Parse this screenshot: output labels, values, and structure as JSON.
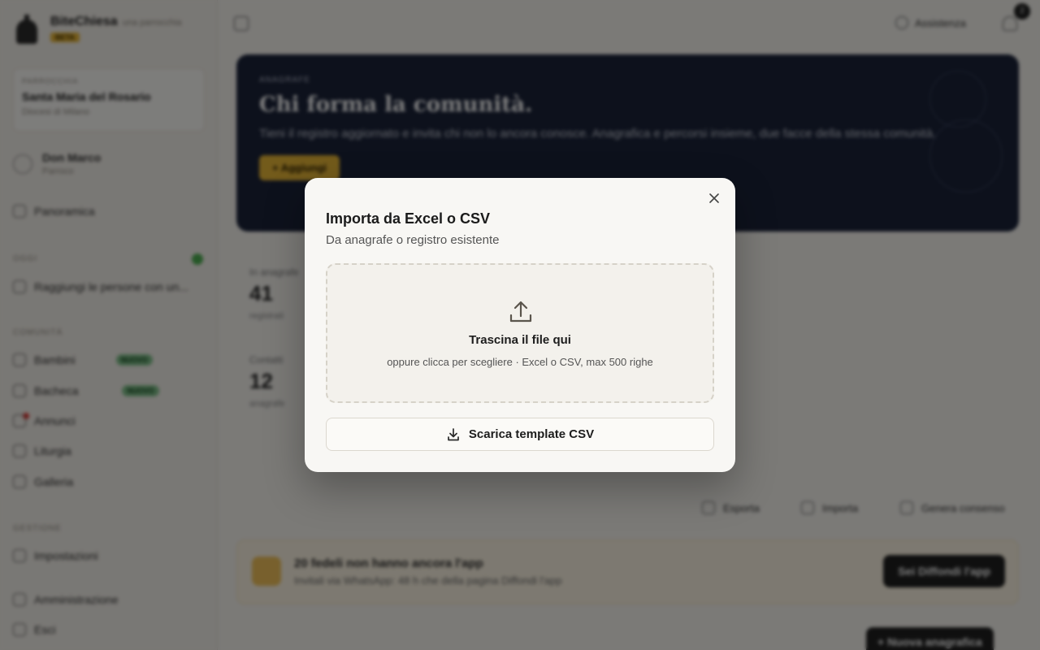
{
  "app": {
    "name": "BiteChiesa",
    "subtitle": "una parrocchia",
    "badge": "BETA"
  },
  "sidebar": {
    "parish_label": "Parrocchia",
    "parish_name": "Santa Maria del Rosario",
    "parish_sub": "Diocesi di Milano",
    "user_name": "Don Marco",
    "user_role": "Parroco",
    "dashboard": "Panoramica",
    "section_today": "Oggi",
    "today_item": "Raggiungi le persone con un...",
    "section_community": "Comunità",
    "items": [
      {
        "label": "Bambini",
        "pill": "NUOVO"
      },
      {
        "label": "Bacheca",
        "pill": "NUOVO"
      },
      {
        "label": "Annunci",
        "pill": ""
      },
      {
        "label": "Liturgia",
        "pill": ""
      },
      {
        "label": "Galleria",
        "pill": ""
      }
    ],
    "section_settings": "Gestione",
    "settings_item": "Impostazioni",
    "bottom_items": [
      "Amministrazione",
      "Esci"
    ]
  },
  "topbar": {
    "help": "Assistenza",
    "notifications_count": "2"
  },
  "hero": {
    "eyebrow": "Anagrafe",
    "title": "Chi forma la comunità.",
    "description": "Tieni il registro aggiornato e invita chi non lo ancora conosce. Anagrafica e percorsi insieme, due facce della stessa comunità.",
    "cta": "+ Aggiungi"
  },
  "stats": [
    {
      "label": "In anagrafe",
      "value": "41",
      "sub": "registrati"
    },
    {
      "label": "Contatti",
      "value": "12",
      "sub": "anagrafe"
    }
  ],
  "actions": {
    "export": "Esporta",
    "import": "Importa",
    "send": "Genera consenso"
  },
  "alert": {
    "title": "20 fedeli non hanno ancora l'app",
    "text": "Invitali via WhatsApp: 48 h che della pagina Diffondi l'app",
    "button": "Sei Diffondi l'app"
  },
  "new_button": "+ Nuova anagrafica",
  "modal": {
    "title": "Importa da Excel o CSV",
    "subtitle": "Da anagrafe o registro esistente",
    "drop_title": "Trascina il file qui",
    "drop_hint": "oppure clicca per scegliere · Excel o CSV, max 500 righe",
    "template_button": "Scarica template CSV"
  }
}
